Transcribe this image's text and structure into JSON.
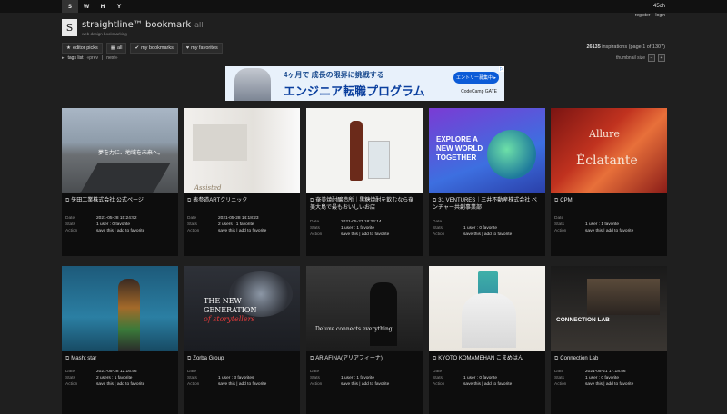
{
  "topnav": {
    "tabs": [
      "S",
      "W",
      "H",
      "Y"
    ],
    "link": "45ch"
  },
  "account": {
    "register": "register",
    "login": "login"
  },
  "header": {
    "logo_letter": "S",
    "brand": "straightline™ bookmark",
    "brand_suffix": "all",
    "tagline": "web design bookmarking"
  },
  "nav": {
    "items": [
      "editor picks",
      "all",
      "my bookmarks",
      "my favorites"
    ]
  },
  "count": {
    "number": "26135",
    "label": "inspirations (page 1 of 1307)"
  },
  "subnav": {
    "tags": "tags list",
    "prev": "«prev",
    "sep": "|",
    "next": "next»"
  },
  "thumb": {
    "label": "thumbnail size",
    "minus": "−",
    "plus": "+"
  },
  "ad": {
    "line1": "4ヶ月で 成長の限界に挑戦する",
    "line2": "エンジニア転職プログラム",
    "cta": "エントリー募集中 ▸",
    "company": "CodeCamp GATE"
  },
  "labels": {
    "date": "Date",
    "stats": "Stats",
    "action": "Action",
    "save_link": "save this | add to favorite"
  },
  "cards": [
    {
      "title": "矢田工業株式会社 公式ページ",
      "date": "2021-05-28 15:24:52",
      "stats": "1 user : 0 favorite"
    },
    {
      "title": "表参道ARTクリニック",
      "date": "2021-05-28 14:18:23",
      "stats": "2 users : 1 favorite"
    },
    {
      "title": "奄美焼酎醸造所｜黒糖焼酎を飲むなら奄美大島で最もおいしいお店",
      "date": "2021-05-27 18:24:14",
      "stats": "1 user : 1 favorite"
    },
    {
      "title": "31 VENTURES｜三井不動産株式会社 ベンチャー共創事業部",
      "date": "",
      "stats": "1 user : 0 favorite"
    },
    {
      "title": "CPM",
      "date": "",
      "stats": "1 user : 1 favorite"
    },
    {
      "title": "Masht star",
      "date": "2021-05-28 12:16:56",
      "stats": "2 users : 1 favorite"
    },
    {
      "title": "Zorba Group",
      "date": "",
      "stats": "1 user : 3 favorites"
    },
    {
      "title": "ARIAFINA(アリアフィーナ)",
      "date": "",
      "stats": "1 user : 1 favorite"
    },
    {
      "title": "KYOTO KOMAMEHAN こまめはん",
      "date": "",
      "stats": "1 user : 0 favorite"
    },
    {
      "title": "Connection Lab",
      "date": "2021-05-21 17:18:56",
      "stats": "1 user : 0 favorite"
    }
  ],
  "thumbtext": {
    "t1": "夢を力に、地域を未来へ。",
    "t2a": "EXPLORE A",
    "t2b": "NEW WORLD",
    "t2c": "TOGETHER",
    "t3a": "Allure",
    "t3b": "Éclatante",
    "t4a": "THE NEW",
    "t4b": "GENERATION",
    "t4c": "of storytellers",
    "t5": "Deluxe connects everything",
    "t6": "CONNECTION LAB",
    "t7": "Assisted"
  }
}
